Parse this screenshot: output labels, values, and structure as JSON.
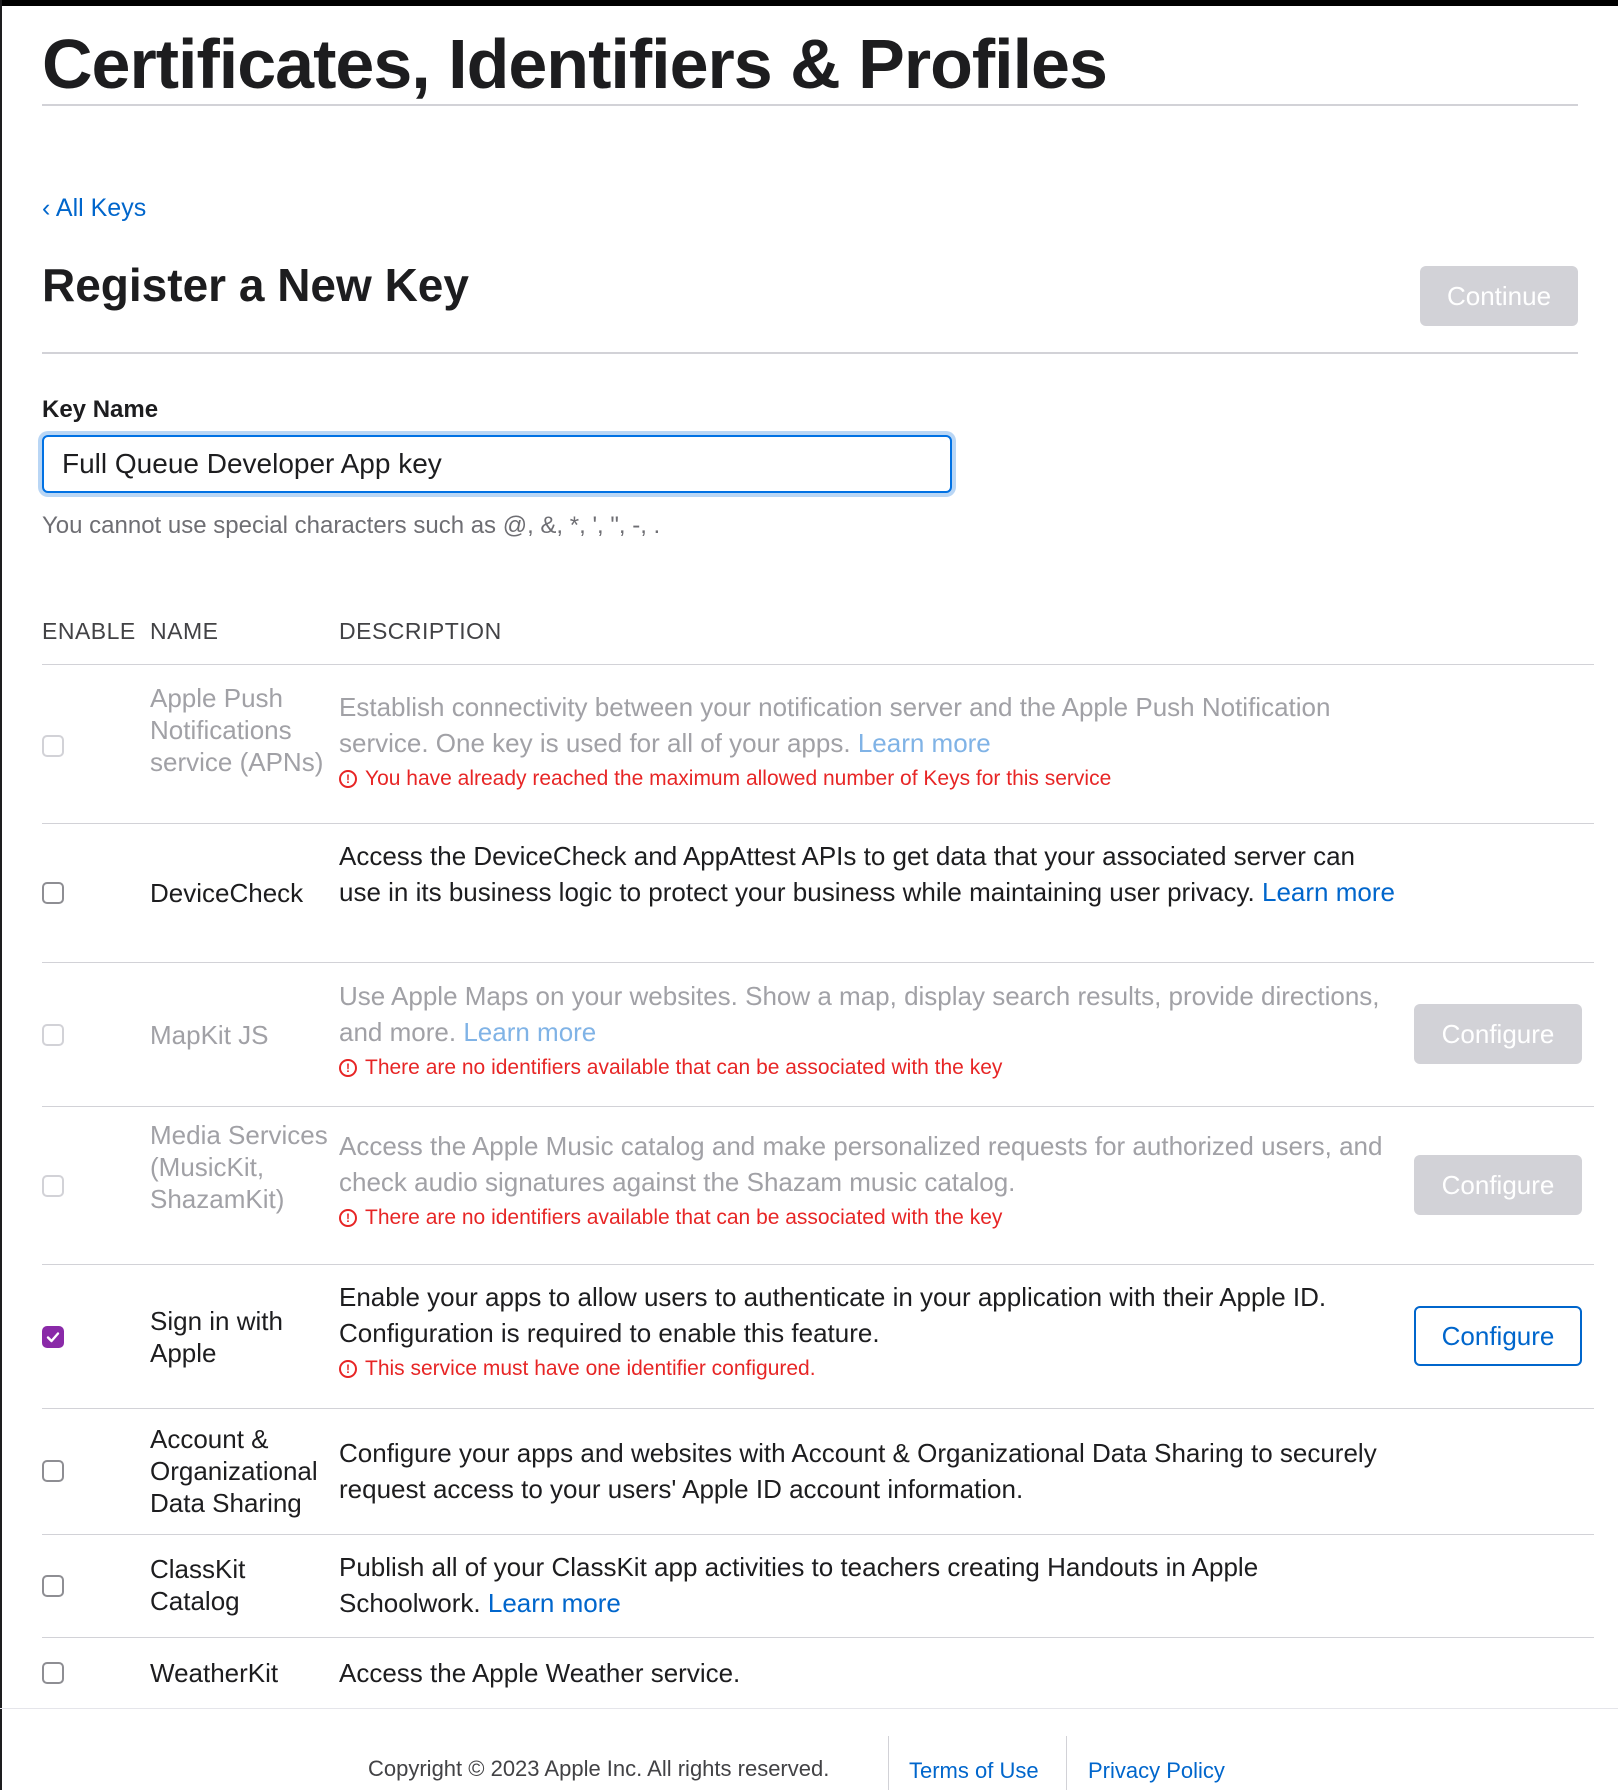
{
  "page": {
    "title": "Certificates, Identifiers & Profiles",
    "back_link": "‹ All Keys",
    "section_title": "Register a New Key",
    "continue_label": "Continue"
  },
  "form": {
    "key_name_label": "Key Name",
    "key_name_value": "Full Queue Developer App key",
    "hint": "You cannot use special characters such as @, &, *, ', \", -, ."
  },
  "table": {
    "headers": {
      "enable": "ENABLE",
      "name": "NAME",
      "description": "DESCRIPTION"
    },
    "rows": [
      {
        "name": "Apple Push Notifications service (APNs)",
        "description": "Establish connectivity between your notification server and the Apple Push Notification service. One key is used for all of your apps.",
        "link": "Learn more",
        "warning": "You have already reached the maximum allowed number of Keys for this service",
        "enabled": false,
        "checked": false
      },
      {
        "name": "DeviceCheck",
        "description": "Access the DeviceCheck and AppAttest APIs to get data that your associated server can use in its business logic to protect your business while maintaining user privacy.",
        "link": "Learn more",
        "enabled": true,
        "checked": false
      },
      {
        "name": "MapKit JS",
        "description": "Use Apple Maps on your websites. Show a map, display search results, provide directions, and more.",
        "link": "Learn more",
        "warning": "There are no identifiers available that can be associated with the key",
        "configure": "Configure",
        "enabled": false,
        "checked": false
      },
      {
        "name": "Media Services (MusicKit, ShazamKit)",
        "description": "Access the Apple Music catalog and make personalized requests for authorized users, and check audio signatures against the Shazam music catalog.",
        "warning": "There are no identifiers available that can be associated with the key",
        "configure": "Configure",
        "enabled": false,
        "checked": false
      },
      {
        "name": "Sign in with Apple",
        "description": "Enable your apps to allow users to authenticate in your application with their Apple ID. Configuration is required to enable this feature.",
        "warning": "This service must have one identifier configured.",
        "configure": "Configure",
        "enabled": true,
        "checked": true
      },
      {
        "name": "Account & Organizational Data Sharing",
        "description": "Configure your apps and websites with Account & Organizational Data Sharing to securely request access to your users' Apple ID account information.",
        "enabled": true,
        "checked": false
      },
      {
        "name": "ClassKit Catalog",
        "description": "Publish all of your ClassKit app activities to teachers creating Handouts in Apple Schoolwork.",
        "link": "Learn more",
        "enabled": true,
        "checked": false
      },
      {
        "name": "WeatherKit",
        "description": "Access the Apple Weather service.",
        "enabled": true,
        "checked": false
      }
    ]
  },
  "footer": {
    "copyright": "Copyright © 2023 Apple Inc. All rights reserved.",
    "terms": "Terms of Use",
    "privacy": "Privacy Policy"
  },
  "colors": {
    "link": "#0066cc",
    "warning": "#e30000",
    "checkbox_checked": "#8a2aa8",
    "disabled_button": "#d2d2d7"
  }
}
